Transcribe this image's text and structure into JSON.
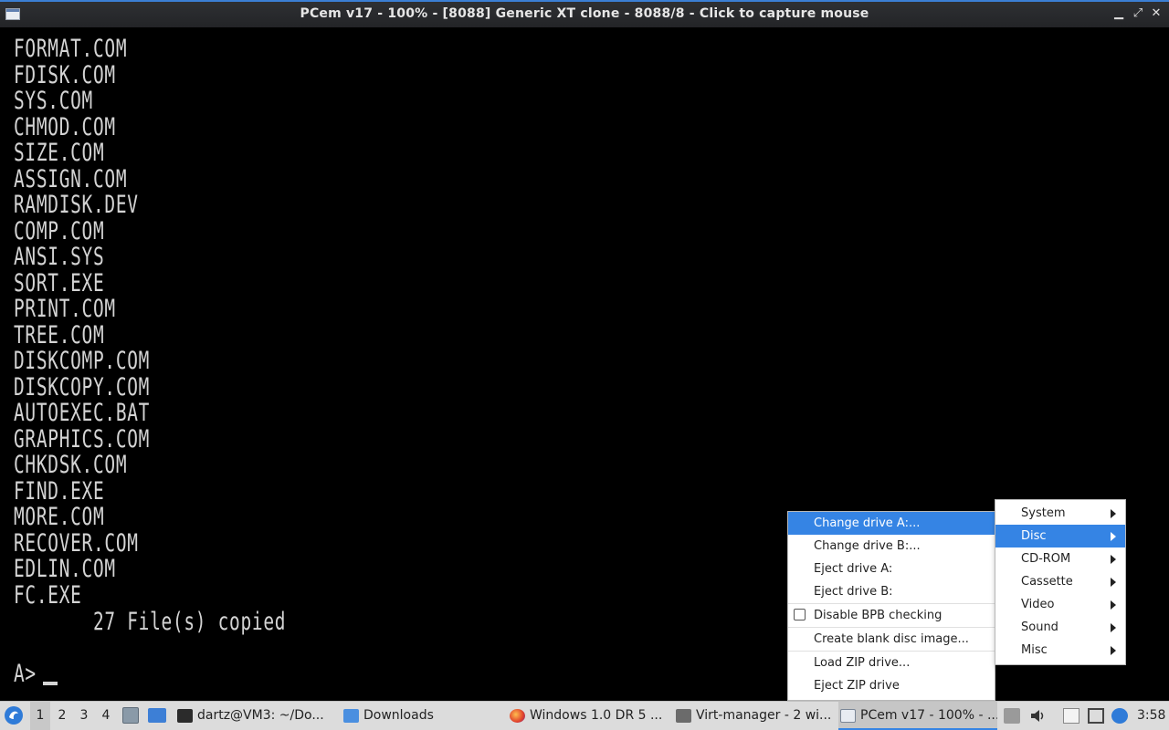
{
  "window": {
    "title": "PCem v17 - 100% - [8088] Generic XT clone - 8088/8 - Click to capture mouse",
    "buttons": [
      "▁",
      "⤢",
      "✕"
    ]
  },
  "console": {
    "lines": [
      "FORMAT.COM",
      "FDISK.COM",
      "SYS.COM",
      "CHMOD.COM",
      "SIZE.COM",
      "ASSIGN.COM",
      "RAMDISK.DEV",
      "COMP.COM",
      "ANSI.SYS",
      "SORT.EXE",
      "PRINT.COM",
      "TREE.COM",
      "DISKCOMP.COM",
      "DISKCOPY.COM",
      "AUTOEXEC.BAT",
      "GRAPHICS.COM",
      "CHKDSK.COM",
      "FIND.EXE",
      "MORE.COM",
      "RECOVER.COM",
      "EDLIN.COM",
      "FC.EXE",
      "       27 File(s) copied",
      "",
      "A>"
    ]
  },
  "main_menu": {
    "items": [
      "System",
      "Disc",
      "CD-ROM",
      "Cassette",
      "Video",
      "Sound",
      "Misc"
    ],
    "selected": "Disc"
  },
  "disc_menu": {
    "change_a": "Change drive A:...",
    "change_b": "Change drive B:...",
    "eject_a": "Eject drive A:",
    "eject_b": "Eject drive B:",
    "disable_bpb": "Disable BPB checking",
    "create_blank": "Create blank disc image...",
    "load_zip": "Load ZIP drive...",
    "eject_zip": "Eject ZIP drive"
  },
  "taskbar": {
    "workspaces": [
      "1",
      "2",
      "3",
      "4"
    ],
    "tasks": {
      "terminal": "dartz@VM3: ~/Do...",
      "downloads": "Downloads",
      "firefox": "Windows 1.0 DR 5 ...",
      "virt": "Virt-manager - 2 wi...",
      "pcem": "PCem v17 - 100% - ..."
    },
    "clock": "3:58"
  },
  "colors": {
    "accent": "#3584e4",
    "console_text": "#d4d4d4",
    "console_bg": "#000000"
  }
}
